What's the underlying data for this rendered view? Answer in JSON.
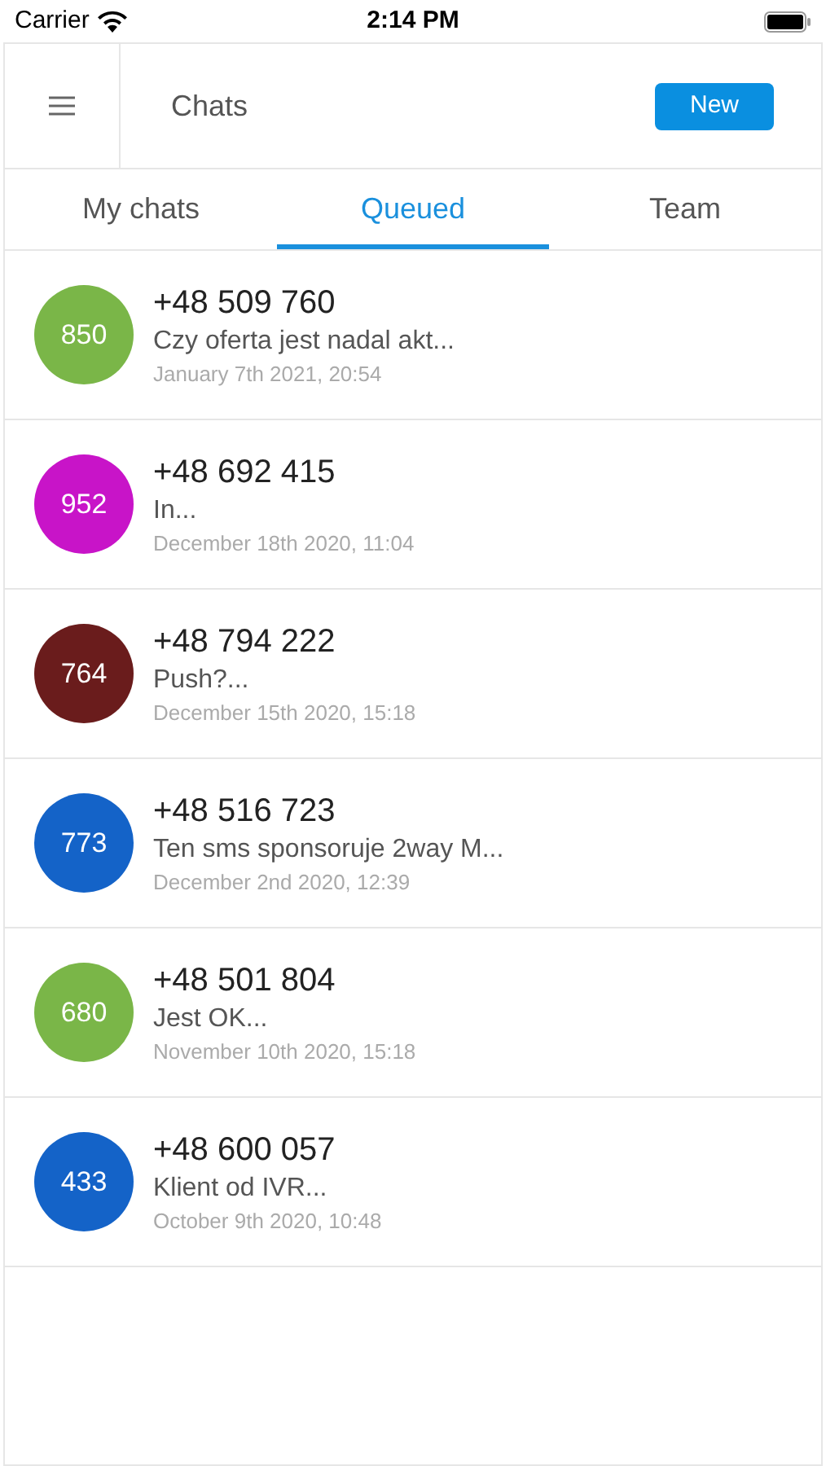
{
  "status_bar": {
    "carrier": "Carrier",
    "time": "2:14 PM"
  },
  "header": {
    "title": "Chats",
    "new_button": "New"
  },
  "tabs": [
    {
      "label": "My chats",
      "selected": false
    },
    {
      "label": "Queued",
      "selected": true
    },
    {
      "label": "Team",
      "selected": false
    }
  ],
  "chats": [
    {
      "badge": "850",
      "color": "#7ab648",
      "phone": "+48 509 760",
      "message": "Czy oferta jest nadal akt...",
      "date": "January 7th 2021, 20:54"
    },
    {
      "badge": "952",
      "color": "#c814c8",
      "phone": "+48 692 415",
      "message": "In...",
      "date": "December 18th 2020, 11:04"
    },
    {
      "badge": "764",
      "color": "#6a1c1c",
      "phone": "+48 794 222",
      "message": "Push?...",
      "date": "December 15th 2020, 15:18"
    },
    {
      "badge": "773",
      "color": "#1463c8",
      "phone": "+48 516 723",
      "message": "Ten sms sponsoruje 2way M...",
      "date": "December 2nd 2020, 12:39"
    },
    {
      "badge": "680",
      "color": "#7ab648",
      "phone": "+48 501 804",
      "message": "Jest OK...",
      "date": "November 10th 2020, 15:18"
    },
    {
      "badge": "433",
      "color": "#1463c8",
      "phone": "+48 600 057",
      "message": "Klient od IVR...",
      "date": "October 9th 2020, 10:48"
    }
  ]
}
